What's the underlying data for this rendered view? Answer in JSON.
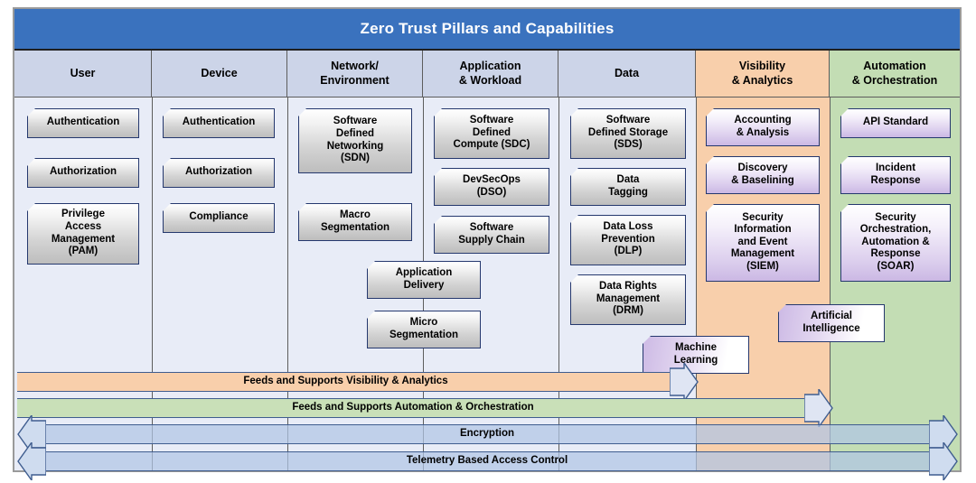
{
  "title": "Zero Trust Pillars and Capabilities",
  "colors": {
    "title_bar": "#3a72be",
    "pillar_header": "#ccd4e8",
    "visibility_band": "#f8cfab",
    "automation_band": "#c3ddb4",
    "box_border": "#25386e",
    "arrow_border": "#3f5d8f",
    "canvas": "#e8ecf7"
  },
  "pillars": [
    {
      "name": "User",
      "accent": "none"
    },
    {
      "name": "Device",
      "accent": "none"
    },
    {
      "name": "Network/\nEnvironment",
      "accent": "none"
    },
    {
      "name": "Application\n& Workload",
      "accent": "none"
    },
    {
      "name": "Data",
      "accent": "none"
    },
    {
      "name": "Visibility\n& Analytics",
      "accent": "orange"
    },
    {
      "name": "Automation\n& Orchestration",
      "accent": "green"
    }
  ],
  "capabilities": [
    {
      "id": "user-authentication",
      "label": "Authentication",
      "style": "grey",
      "pillar": "User"
    },
    {
      "id": "user-authorization",
      "label": "Authorization",
      "style": "grey",
      "pillar": "User"
    },
    {
      "id": "user-pam",
      "label": "Privilege\nAccess\nManagement\n(PAM)",
      "style": "grey",
      "pillar": "User"
    },
    {
      "id": "device-authentication",
      "label": "Authentication",
      "style": "grey",
      "pillar": "Device"
    },
    {
      "id": "device-authorization",
      "label": "Authorization",
      "style": "grey",
      "pillar": "Device"
    },
    {
      "id": "device-compliance",
      "label": "Compliance",
      "style": "grey",
      "pillar": "Device"
    },
    {
      "id": "network-sdn",
      "label": "Software\nDefined\nNetworking\n(SDN)",
      "style": "grey",
      "pillar": "Network/Environment"
    },
    {
      "id": "network-macro-seg",
      "label": "Macro\nSegmentation",
      "style": "grey",
      "pillar": "Network/Environment"
    },
    {
      "id": "app-sdc",
      "label": "Software\nDefined\nCompute (SDC)",
      "style": "grey",
      "pillar": "Application & Workload"
    },
    {
      "id": "app-devsecops",
      "label": "DevSecOps\n(DSO)",
      "style": "grey",
      "pillar": "Application & Workload"
    },
    {
      "id": "app-supply-chain",
      "label": "Software\nSupply Chain",
      "style": "grey",
      "pillar": "Application & Workload"
    },
    {
      "id": "application-delivery",
      "label": "Application\nDelivery",
      "style": "grey",
      "pillar": "Network/Environment + Application & Workload"
    },
    {
      "id": "micro-segmentation",
      "label": "Micro\nSegmentation",
      "style": "grey",
      "pillar": "Network/Environment + Application & Workload"
    },
    {
      "id": "data-sds",
      "label": "Software\nDefined Storage\n(SDS)",
      "style": "grey",
      "pillar": "Data"
    },
    {
      "id": "data-tagging",
      "label": "Data\nTagging",
      "style": "grey",
      "pillar": "Data"
    },
    {
      "id": "data-dlp",
      "label": "Data Loss\nPrevention\n(DLP)",
      "style": "grey",
      "pillar": "Data"
    },
    {
      "id": "data-drm",
      "label": "Data Rights\nManagement\n(DRM)",
      "style": "grey",
      "pillar": "Data"
    },
    {
      "id": "vis-accounting",
      "label": "Accounting\n& Analysis",
      "style": "purple",
      "pillar": "Visibility & Analytics"
    },
    {
      "id": "vis-discovery",
      "label": "Discovery\n& Baselining",
      "style": "purple",
      "pillar": "Visibility & Analytics"
    },
    {
      "id": "vis-siem",
      "label": "Security\nInformation\nand Event\nManagement\n(SIEM)",
      "style": "purple",
      "pillar": "Visibility & Analytics"
    },
    {
      "id": "aut-api-standard",
      "label": "API Standard",
      "style": "purple",
      "pillar": "Automation & Orchestration"
    },
    {
      "id": "aut-incident-response",
      "label": "Incident\nResponse",
      "style": "purple",
      "pillar": "Automation & Orchestration"
    },
    {
      "id": "aut-soar",
      "label": "Security\nOrchestration,\nAutomation &\nResponse\n(SOAR)",
      "style": "purple",
      "pillar": "Automation & Orchestration"
    },
    {
      "id": "machine-learning",
      "label": "Machine\nLearning",
      "style": "purple-h",
      "pillar": "Data + Visibility & Analytics"
    },
    {
      "id": "artificial-intelligence",
      "label": "Artificial\nIntelligence",
      "style": "purple-h",
      "pillar": "Visibility & Analytics + Automation & Orchestration"
    }
  ],
  "cross_cutting_arrows": [
    {
      "id": "feeds-visibility",
      "label": "Feeds and Supports Visibility & Analytics",
      "color": "orange",
      "direction": "right"
    },
    {
      "id": "feeds-automation",
      "label": "Feeds and Supports Automation & Orchestration",
      "color": "green",
      "direction": "right"
    },
    {
      "id": "encryption",
      "label": "Encryption",
      "color": "blue",
      "direction": "both"
    },
    {
      "id": "telemetry-access",
      "label": "Telemetry Based Access Control",
      "color": "blue",
      "direction": "both"
    }
  ]
}
